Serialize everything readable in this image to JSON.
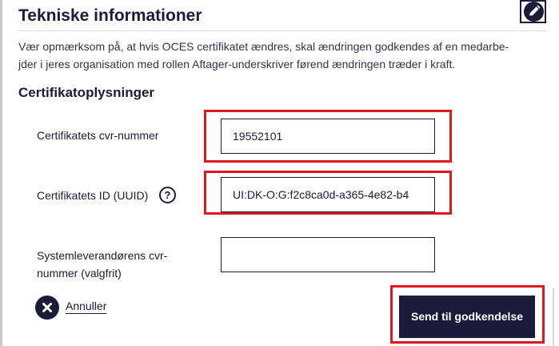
{
  "section": {
    "title": "Tekniske informationer",
    "intro_line1": "Vær opmærksom på, at hvis OCES certifikatet ændres, skal ændringen godkendes af en medarbe-",
    "intro_line2": "jder i jeres organisation med rollen Aftager-underskriver førend ændringen træder i kraft.",
    "edit_icon": "pencil-icon"
  },
  "certificate": {
    "heading": "Certifikatoplysninger",
    "cvr_label": "Certifikatets cvr-nummer",
    "cvr_value": "19552101",
    "uuid_label": "Certifikatets ID (UUID)",
    "uuid_help": "?",
    "uuid_value": "UI:DK-O:G:f2c8ca0d-a365-4e82-b4",
    "supplier_label_line1": "Systemleverandørens cvr-",
    "supplier_label_line2": "nummer (valgfrit)",
    "supplier_value": ""
  },
  "actions": {
    "cancel_label": "Annuller",
    "cancel_icon": "close-icon",
    "submit_label": "Send til godkendelse"
  },
  "colors": {
    "navy": "#1b1b3a",
    "highlight": "#e0191f"
  }
}
